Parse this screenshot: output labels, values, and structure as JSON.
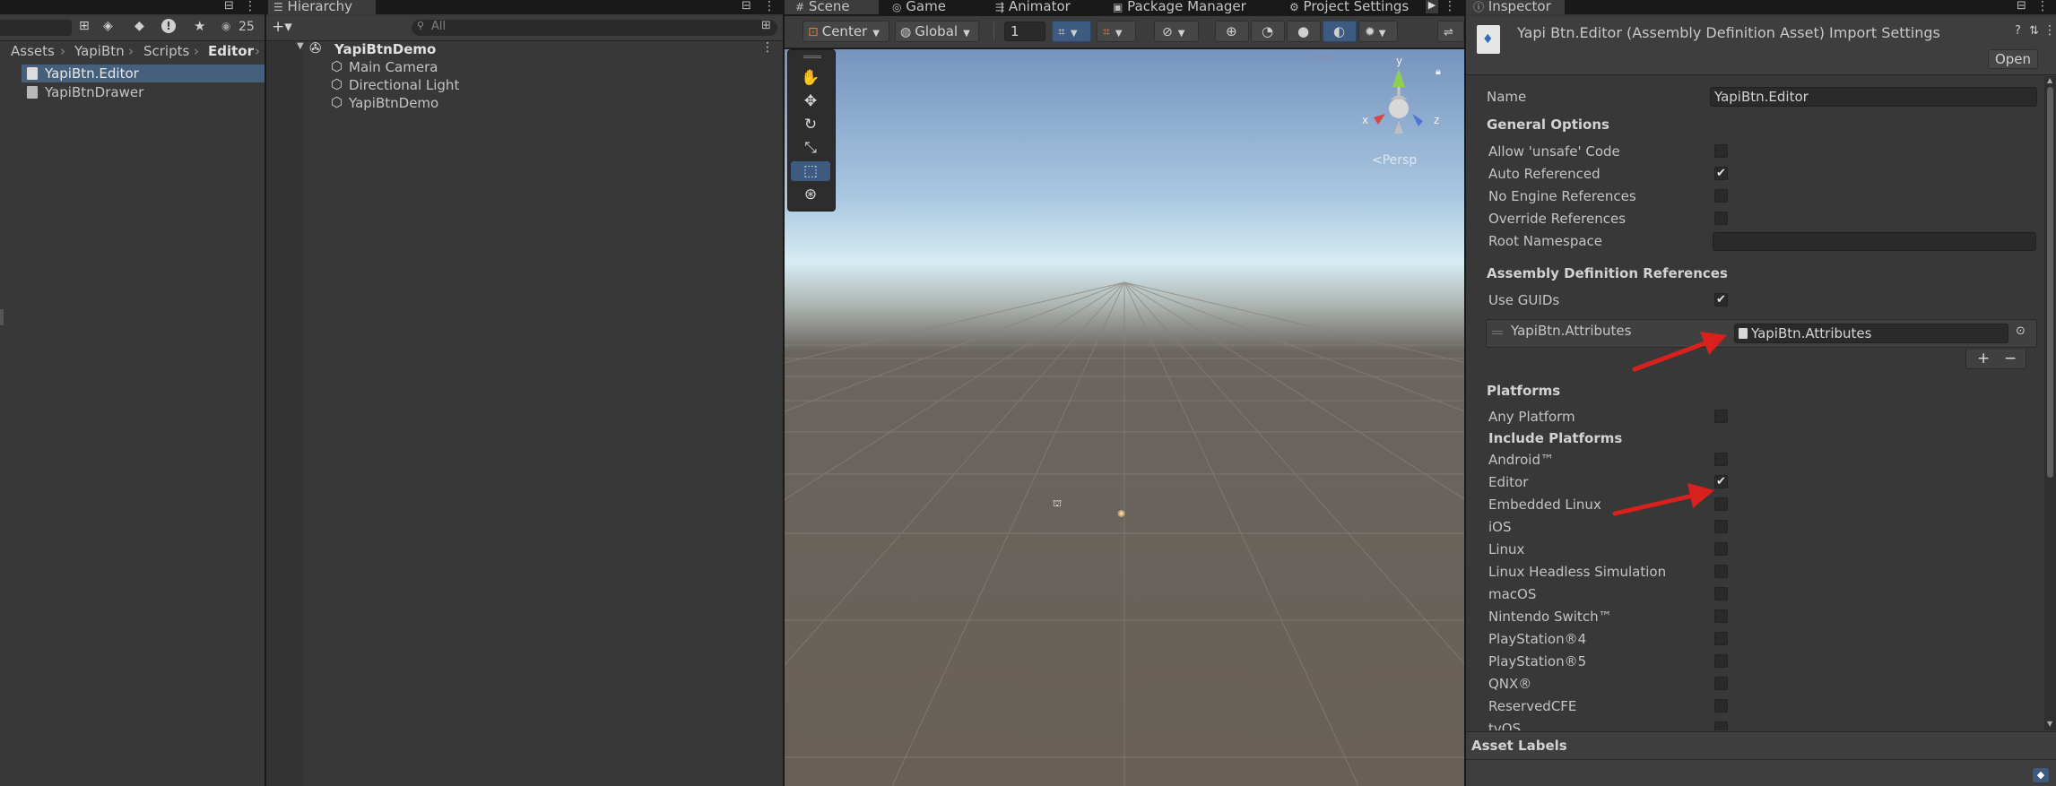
{
  "project": {
    "tab_lock": "⊟",
    "tab_menu": "⋮",
    "toolbar_count": "25",
    "breadcrumb": [
      "Assets",
      "YapiBtn",
      "Scripts",
      "Editor"
    ],
    "breadcrumb_sep": "›",
    "files": [
      "YapiBtn.Editor",
      "YapiBtnDrawer"
    ]
  },
  "hierarchy": {
    "tab_label": "Hierarchy",
    "add_label": "+▾",
    "search_placeholder": "All",
    "scene": "YapiBtnDemo",
    "objects": [
      "Main Camera",
      "Directional Light",
      "YapiBtnDemo"
    ]
  },
  "tabs": {
    "scene": "Scene",
    "game": "Game",
    "animator": "Animator",
    "package_manager": "Package Manager",
    "project_settings": "Project Settings"
  },
  "scene_toolbar": {
    "pivot": "Center",
    "space": "Global",
    "grid_value": "1",
    "persp_label": "<Persp",
    "gizmo_x": "x",
    "gizmo_y": "y",
    "gizmo_z": "z"
  },
  "inspector": {
    "tab_label": "Inspector",
    "title": "Yapi Btn.Editor (Assembly Definition Asset) Import Settings",
    "open_button": "Open",
    "name_label": "Name",
    "name_value": "YapiBtn.Editor",
    "general_options": "General Options",
    "options": [
      {
        "label": "Allow 'unsafe' Code",
        "checked": false
      },
      {
        "label": "Auto Referenced",
        "checked": true
      },
      {
        "label": "No Engine References",
        "checked": false
      },
      {
        "label": "Override References",
        "checked": false
      }
    ],
    "root_namespace_label": "Root Namespace",
    "root_namespace_value": "",
    "assembly_refs": "Assembly Definition References",
    "use_guids_label": "Use GUIDs",
    "use_guids_checked": true,
    "reference_label": "YapiBtn.Attributes",
    "reference_value": "YapiBtn.Attributes",
    "add_button": "+",
    "remove_button": "−",
    "platforms": "Platforms",
    "any_platform": "Any Platform",
    "any_platform_checked": false,
    "include_platforms": "Include Platforms",
    "platform_list": [
      {
        "label": "Android™",
        "checked": false
      },
      {
        "label": "Editor",
        "checked": true
      },
      {
        "label": "Embedded Linux",
        "checked": false
      },
      {
        "label": "iOS",
        "checked": false
      },
      {
        "label": "Linux",
        "checked": false
      },
      {
        "label": "Linux Headless Simulation",
        "checked": false
      },
      {
        "label": "macOS",
        "checked": false
      },
      {
        "label": "Nintendo Switch™",
        "checked": false
      },
      {
        "label": "PlayStation®4",
        "checked": false
      },
      {
        "label": "PlayStation®5",
        "checked": false
      },
      {
        "label": "QNX®",
        "checked": false
      },
      {
        "label": "ReservedCFE",
        "checked": false
      },
      {
        "label": "tvOS",
        "checked": false
      }
    ],
    "asset_labels": "Asset Labels"
  },
  "colors": {
    "annotation_arrow": "#d8201c",
    "selection": "#2c5d87",
    "panel": "#383838"
  }
}
